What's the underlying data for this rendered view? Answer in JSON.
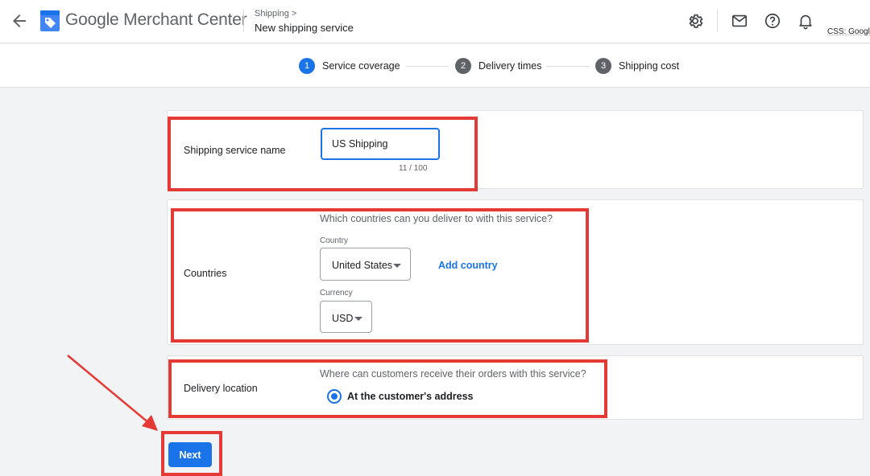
{
  "header": {
    "brand": "Google Merchant Center",
    "breadcrumb_parent": "Shipping",
    "breadcrumb_separator": ">",
    "page_title": "New shipping service",
    "account_label": "CSS: Google",
    "icons": [
      "back-arrow-icon",
      "merchant-center-logo-icon",
      "gear-icon",
      "mail-icon",
      "help-icon",
      "bell-icon"
    ]
  },
  "stepper": {
    "steps": [
      {
        "number": "1",
        "label": "Service coverage",
        "state": "active",
        "color": "#1a73e8"
      },
      {
        "number": "2",
        "label": "Delivery times",
        "state": "upcoming",
        "color": "#5f6368"
      },
      {
        "number": "3",
        "label": "Shipping cost",
        "state": "upcoming",
        "color": "#5f6368"
      }
    ]
  },
  "name_section": {
    "label": "Shipping service name",
    "value": "US Shipping",
    "counter": "11 / 100"
  },
  "countries_section": {
    "label": "Countries",
    "question": "Which countries can you deliver to with this service?",
    "country_label": "Country",
    "country_value": "United States",
    "add_country": "Add country",
    "currency_label": "Currency",
    "currency_value": "USD"
  },
  "delivery_section": {
    "label": "Delivery location",
    "question": "Where can customers receive their orders with this service?",
    "option_label": "At the customer's address",
    "option_selected": true
  },
  "footer": {
    "next_label": "Next"
  },
  "colors": {
    "accent": "#1a73e8",
    "highlight": "#e53935",
    "background": "#f1f3f4"
  }
}
